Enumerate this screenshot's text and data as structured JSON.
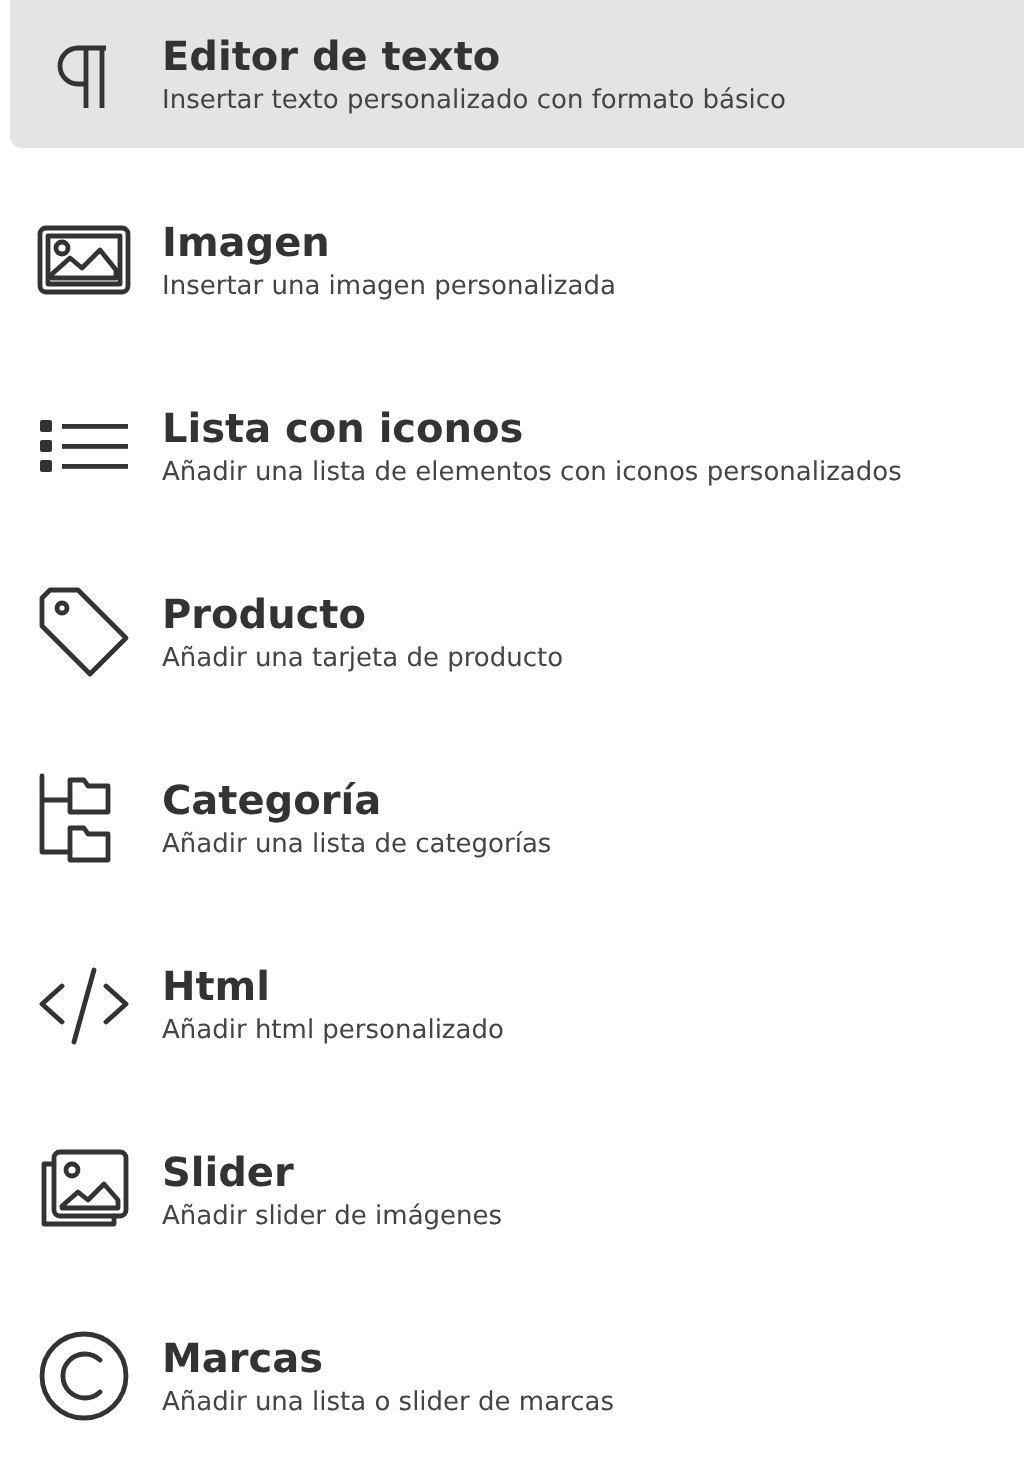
{
  "items": [
    {
      "kind": "paragraph",
      "title": "Editor de texto",
      "description": "Insertar texto personalizado con formato básico",
      "selected": true
    },
    {
      "kind": "image",
      "title": "Imagen",
      "description": "Insertar una imagen personalizada",
      "selected": false
    },
    {
      "kind": "list",
      "title": "Lista con iconos",
      "description": "Añadir una lista de elementos con iconos personalizados",
      "selected": false
    },
    {
      "kind": "tag",
      "title": "Producto",
      "description": "Añadir una tarjeta de producto",
      "selected": false
    },
    {
      "kind": "folders",
      "title": "Categoría",
      "description": "Añadir una lista de categorías",
      "selected": false
    },
    {
      "kind": "code",
      "title": "Html",
      "description": "Añadir html personalizado",
      "selected": false
    },
    {
      "kind": "gallery",
      "title": "Slider",
      "description": "Añadir slider de imágenes",
      "selected": false
    },
    {
      "kind": "copyright",
      "title": "Marcas",
      "description": "Añadir una lista o slider de marcas",
      "selected": false
    }
  ]
}
